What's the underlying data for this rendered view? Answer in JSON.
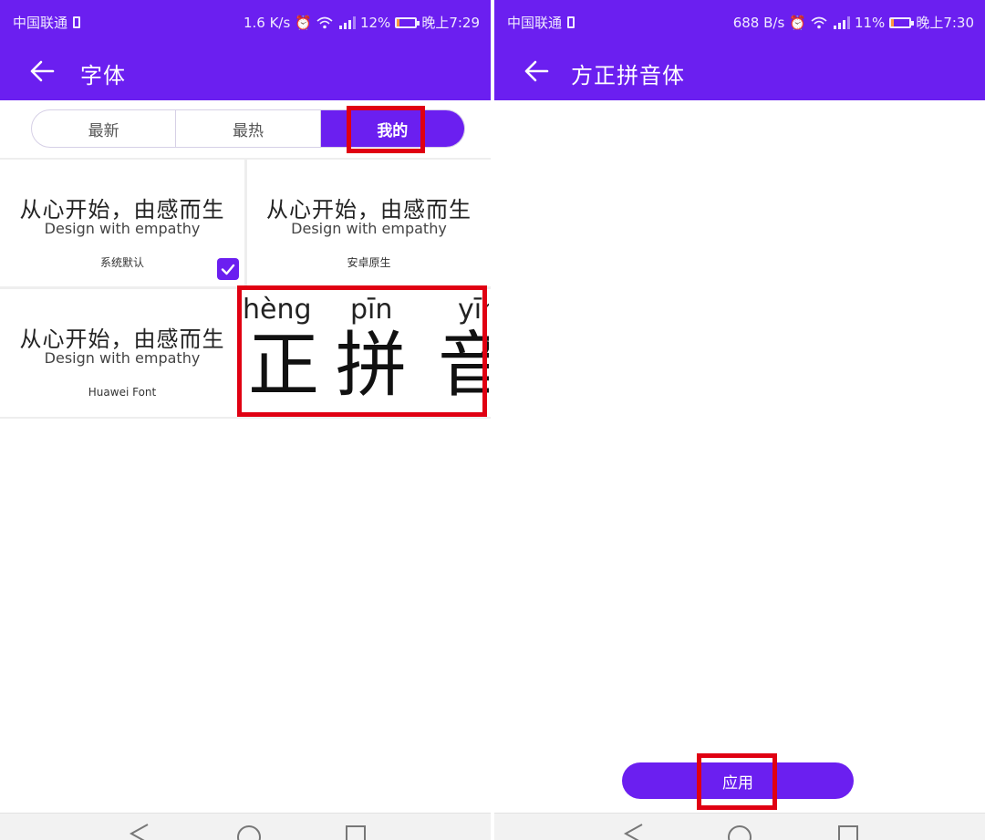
{
  "left": {
    "status": {
      "carrier": "中国联通",
      "speed": "1.6 K/s",
      "battery": "12%",
      "battery_level": 0.12,
      "time": "晚上7:29"
    },
    "appbar": {
      "title": "字体"
    },
    "tabs": [
      {
        "label": "最新"
      },
      {
        "label": "最热"
      },
      {
        "label": "我的",
        "active": true
      }
    ],
    "fonts": [
      {
        "sample_cn": "从心开始，由感而生",
        "sample_en": "Design with empathy",
        "name": "系统默认",
        "selected": true
      },
      {
        "sample_cn": "从心开始，由感而生",
        "sample_en": "Design with empathy",
        "name": "安卓原生",
        "selected": false
      },
      {
        "sample_cn": "从心开始，由感而生",
        "sample_en": "Design with empathy",
        "name": "Huawei Font",
        "selected": false
      }
    ],
    "preview": {
      "pinyin": [
        "hèng",
        "pīn",
        "yīn"
      ],
      "hanzi": [
        "正",
        "拼",
        "音"
      ]
    }
  },
  "right": {
    "status": {
      "carrier": "中国联通",
      "speed": "688 B/s",
      "battery": "11%",
      "battery_level": 0.11,
      "time": "晚上7:30"
    },
    "appbar": {
      "title": "方正拼音体"
    },
    "apply_label": "应用"
  },
  "colors": {
    "accent": "#6b1ff0",
    "highlight": "#e00012"
  },
  "icons": [
    "back-arrow-icon",
    "sim-icon",
    "alarm-icon",
    "wifi-icon",
    "signal-icon",
    "battery-icon",
    "check-icon",
    "nav-back-icon",
    "nav-home-icon",
    "nav-recent-icon"
  ]
}
